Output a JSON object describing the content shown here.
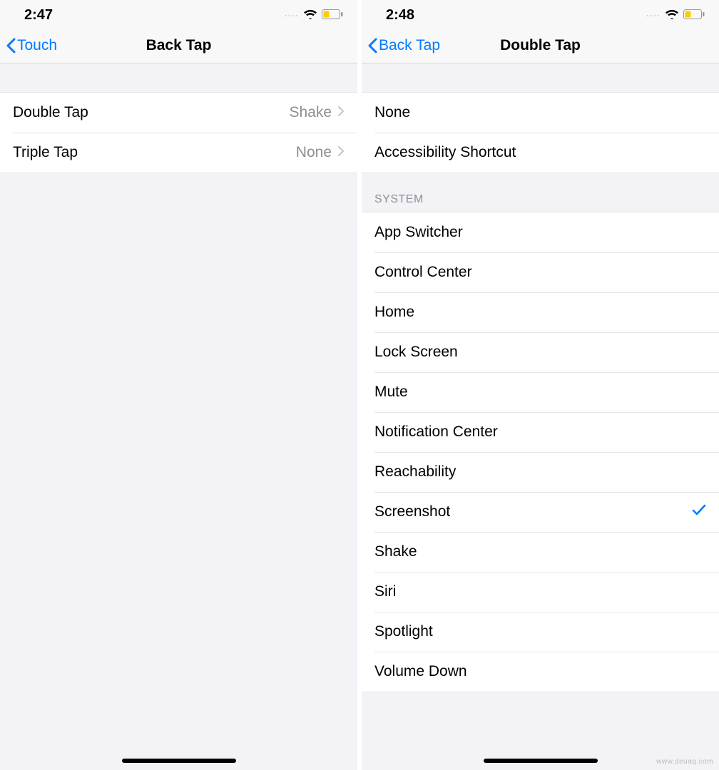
{
  "left": {
    "status": {
      "time": "2:47",
      "dots": "····"
    },
    "nav": {
      "back": "Touch",
      "title": "Back Tap"
    },
    "rows": [
      {
        "label": "Double Tap",
        "value": "Shake"
      },
      {
        "label": "Triple Tap",
        "value": "None"
      }
    ]
  },
  "right": {
    "status": {
      "time": "2:48",
      "dots": "····"
    },
    "nav": {
      "back": "Back Tap",
      "title": "Double Tap"
    },
    "topRows": [
      {
        "label": "None",
        "selected": false
      },
      {
        "label": "Accessibility Shortcut",
        "selected": false
      }
    ],
    "systemHeader": "System",
    "systemRows": [
      {
        "label": "App Switcher",
        "selected": false
      },
      {
        "label": "Control Center",
        "selected": false
      },
      {
        "label": "Home",
        "selected": false
      },
      {
        "label": "Lock Screen",
        "selected": false
      },
      {
        "label": "Mute",
        "selected": false
      },
      {
        "label": "Notification Center",
        "selected": false
      },
      {
        "label": "Reachability",
        "selected": false
      },
      {
        "label": "Screenshot",
        "selected": true
      },
      {
        "label": "Shake",
        "selected": false
      },
      {
        "label": "Siri",
        "selected": false
      },
      {
        "label": "Spotlight",
        "selected": false
      },
      {
        "label": "Volume Down",
        "selected": false
      }
    ]
  },
  "watermark": "www.deuaq.com"
}
